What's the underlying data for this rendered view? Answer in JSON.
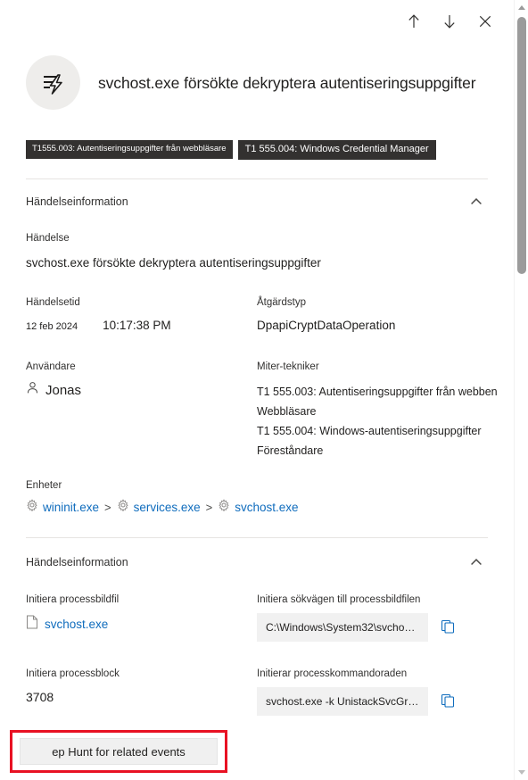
{
  "commandbar": {
    "prev_label": "Föregående",
    "next_label": "Nästa",
    "close_label": "Stäng"
  },
  "header": {
    "icon": "alert-lightning-icon",
    "title": "svchost.exe försökte dekryptera autentiseringsuppgifter"
  },
  "badges": [
    {
      "label": "T1555.003: Autentiseringsuppgifter från webbläsare"
    },
    {
      "label": "T1 555.004: Windows Credential Manager"
    }
  ],
  "section_event": {
    "heading": "Händelseinformation",
    "event_label": "Händelse",
    "event_value": "svchost.exe försökte dekryptera autentiseringsuppgifter",
    "time_label": "Händelsetid",
    "time_date": "12 feb 2024",
    "time_clock": "10:17:38 PM",
    "action_label": "Åtgärdstyp",
    "action_value": "DpapiCryptDataOperation",
    "user_label": "Användare",
    "user_value": "Jonas",
    "mitre_label": "Miter-tekniker",
    "mitre_lines": [
      "T1 555.003: Autentiseringsuppgifter från webben",
      "Webbläsare",
      "T1 555.004: Windows-autentiseringsuppgifter",
      "Föreståndare"
    ],
    "entities_label": "Enheter",
    "entities": [
      {
        "name": "wininit.exe",
        "icon": "gear-icon"
      },
      {
        "name": "services.exe",
        "icon": "gear-icon"
      },
      {
        "name": "svchost.exe",
        "icon": "gear-icon"
      }
    ],
    "entity_separator": ">"
  },
  "section_details": {
    "heading": "Händelseinformation",
    "image_file_label": "Initiera processbildfil",
    "image_file_value": "svchost.exe",
    "image_path_label": "Initiera sökvägen till processbildfilen",
    "image_path_value": "C:\\Windows\\System32\\svchost....",
    "pid_label": "Initiera processblock",
    "pid_value": "3708",
    "cmdline_label": "Initierar processkommandoraden",
    "cmdline_value": "svchost.exe -k UnistackSvcGroup",
    "copy_label": "Kopiera"
  },
  "footer": {
    "hunt_button": "ep Hunt for related events"
  },
  "colors": {
    "link": "#0f6cbd",
    "badge_bg": "#333130",
    "annotation": "#e81123",
    "value_box": "#f1f1f1"
  }
}
